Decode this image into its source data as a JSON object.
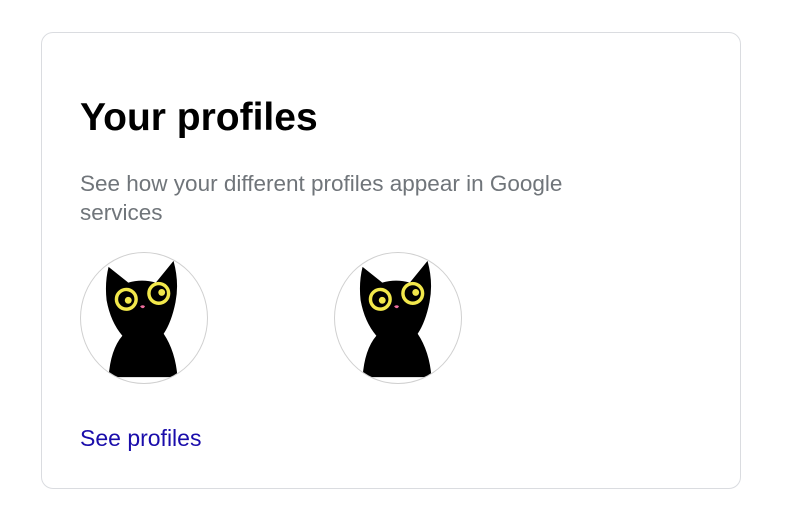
{
  "profiles_card": {
    "title": "Your profiles",
    "description": "See how your different profiles appear in Google services",
    "link_label": "See profiles",
    "avatars": [
      {
        "icon": "cat-avatar-icon"
      },
      {
        "icon": "cat-avatar-icon"
      }
    ]
  },
  "colors": {
    "link": "#1a0dab",
    "description": "#70757a",
    "card_border": "#dadce0",
    "cat_eyes": "#f2e84b",
    "cat_nose": "#f06fa0"
  }
}
